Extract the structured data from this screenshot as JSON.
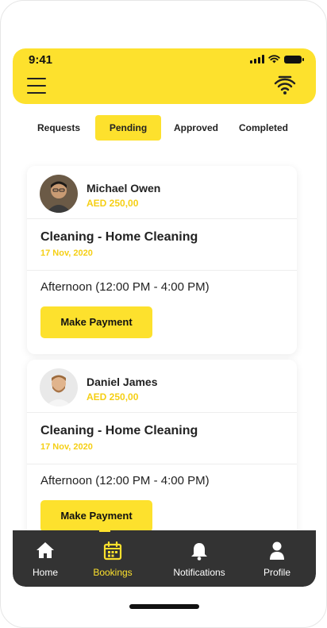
{
  "status_bar": {
    "time": "9:41"
  },
  "header": {
    "menu_icon": "menu-icon",
    "wifi_icon": "wifi-icon"
  },
  "tabs": [
    {
      "label": "Requests",
      "active": false
    },
    {
      "label": "Pending",
      "active": true
    },
    {
      "label": "Approved",
      "active": false
    },
    {
      "label": "Completed",
      "active": false
    }
  ],
  "bookings": [
    {
      "name": "Michael Owen",
      "price": "AED 250,00",
      "service": "Cleaning - Home Cleaning",
      "date": "17 Nov, 2020",
      "slot": "Afternoon (12:00 PM - 4:00 PM)",
      "action_label": "Make Payment"
    },
    {
      "name": "Daniel James",
      "price": "AED 250,00",
      "service": "Cleaning - Home Cleaning",
      "date": "17 Nov, 2020",
      "slot": "Afternoon (12:00 PM - 4:00 PM)",
      "action_label": "Make Payment"
    }
  ],
  "bottom_nav": [
    {
      "label": "Home",
      "icon": "home-icon",
      "active": false
    },
    {
      "label": "Bookings",
      "icon": "calendar-icon",
      "active": true
    },
    {
      "label": "Notifications",
      "icon": "bell-icon",
      "active": false
    },
    {
      "label": "Profile",
      "icon": "user-icon",
      "active": false
    }
  ],
  "colors": {
    "accent": "#fde12d",
    "price": "#f5cf15",
    "nav_bg": "#333333"
  }
}
